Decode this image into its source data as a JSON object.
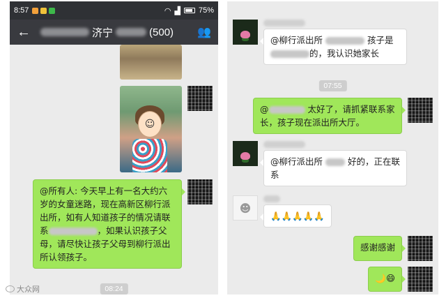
{
  "left": {
    "status": {
      "time": "8:57",
      "battery": "75%"
    },
    "title": {
      "name_visible": "济宁",
      "count": "(500)"
    },
    "messages": {
      "announcement": "@所有人: 今天早上有一名大约六岁的女童迷路，现在高新区柳行派出所，如有人知道孩子的情况请联系",
      "announcement_tail": "，如果认识孩子父母，请尽快让孩子父母到柳行派出所认领孩子。"
    },
    "timestamp": "08:24",
    "watermark": "大众网"
  },
  "right": {
    "messages": {
      "m1_a": "@柳行派出所",
      "m1_b": "孩子是",
      "m1_c": "的，我认识她家长",
      "m2_a": "@",
      "m2_b": "太好了，请抓紧联系家长，孩子现在派出所大厅。",
      "m3_a": "@柳行派出所",
      "m3_b": "好的，正在联系",
      "m4": "🙏🙏🙏🙏🙏",
      "m5": "感谢感谢",
      "m6": "🌙😄"
    },
    "timestamp": "07:55"
  },
  "icons": {
    "back": "arrow-left-icon",
    "group": "group-members-icon",
    "wifi": "wifi-icon",
    "signal": "signal-icon",
    "battery": "battery-icon"
  },
  "colors": {
    "titlebar": "#393a3f",
    "statusbar": "#2f3135",
    "chat_bg": "#ebebeb",
    "bubble_green": "#a0e75a",
    "bubble_white": "#ffffff"
  }
}
